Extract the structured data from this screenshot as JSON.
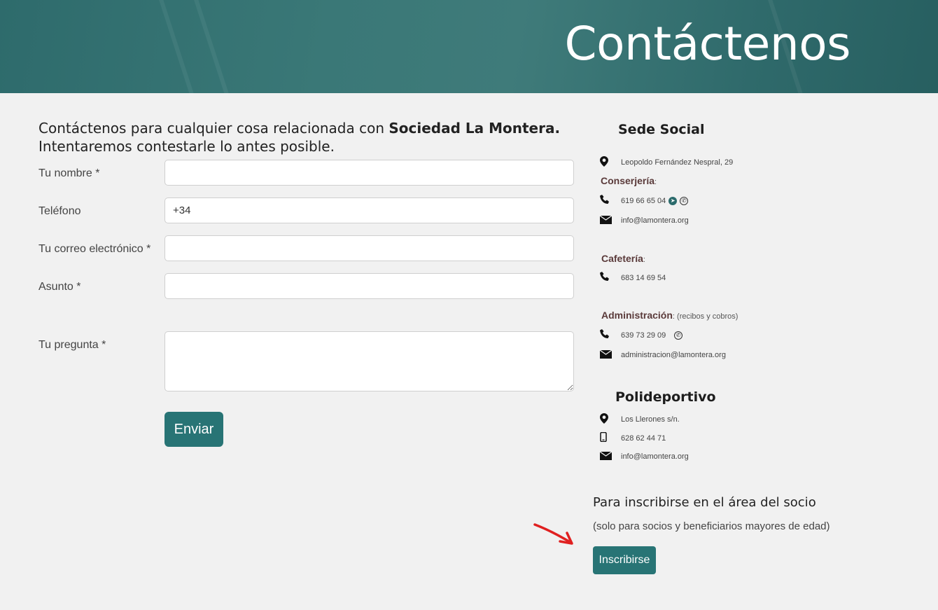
{
  "hero": {
    "title": "Contáctenos"
  },
  "intro": {
    "line1_prefix": "Contáctenos para cualquier cosa relacionada con ",
    "org_name": "Sociedad La Montera.",
    "line2": "Intentaremos contestarle lo antes posible."
  },
  "form": {
    "name_label": "Tu nombre *",
    "name_value": "",
    "phone_label": "Teléfono",
    "phone_value": "+34",
    "email_label": "Tu correo electrónico *",
    "email_value": "",
    "subject_label": "Asunto *",
    "subject_value": "",
    "question_label": "Tu pregunta *",
    "question_value": "",
    "submit_label": "Enviar"
  },
  "sede": {
    "title": "Sede Social",
    "address": "Leopoldo Fernández Nespral, 29",
    "conserjeria": {
      "label": "Conserjería",
      "phone": "619 66 65 04",
      "email": "info@lamontera.org"
    },
    "cafeteria": {
      "label": "Cafetería",
      "phone": "683 14 69 54"
    },
    "administracion": {
      "label": "Administración",
      "note": "(recibos y cobros)",
      "phone": "639 73 29 09",
      "email": "administracion@lamontera.org"
    }
  },
  "polideportivo": {
    "title": "Polideportivo",
    "address": "Los Llerones s/n.",
    "mobile": "628 62 44 71",
    "email": "info@lamontera.org"
  },
  "register": {
    "title": "Para inscribirse en el área del socio",
    "note": "(solo para socios y beneficiarios mayores de edad)",
    "button_label": "Inscribirse"
  },
  "icons": {
    "location": "location-pin-icon",
    "phone": "phone-icon",
    "mail": "envelope-icon",
    "mobile": "mobile-phone-icon",
    "telegram": "telegram-icon",
    "whatsapp": "whatsapp-icon"
  },
  "colors": {
    "accent": "#287475",
    "header": "#3a7877",
    "background": "#f1f1f1",
    "annotation_arrow": "#e02020"
  }
}
